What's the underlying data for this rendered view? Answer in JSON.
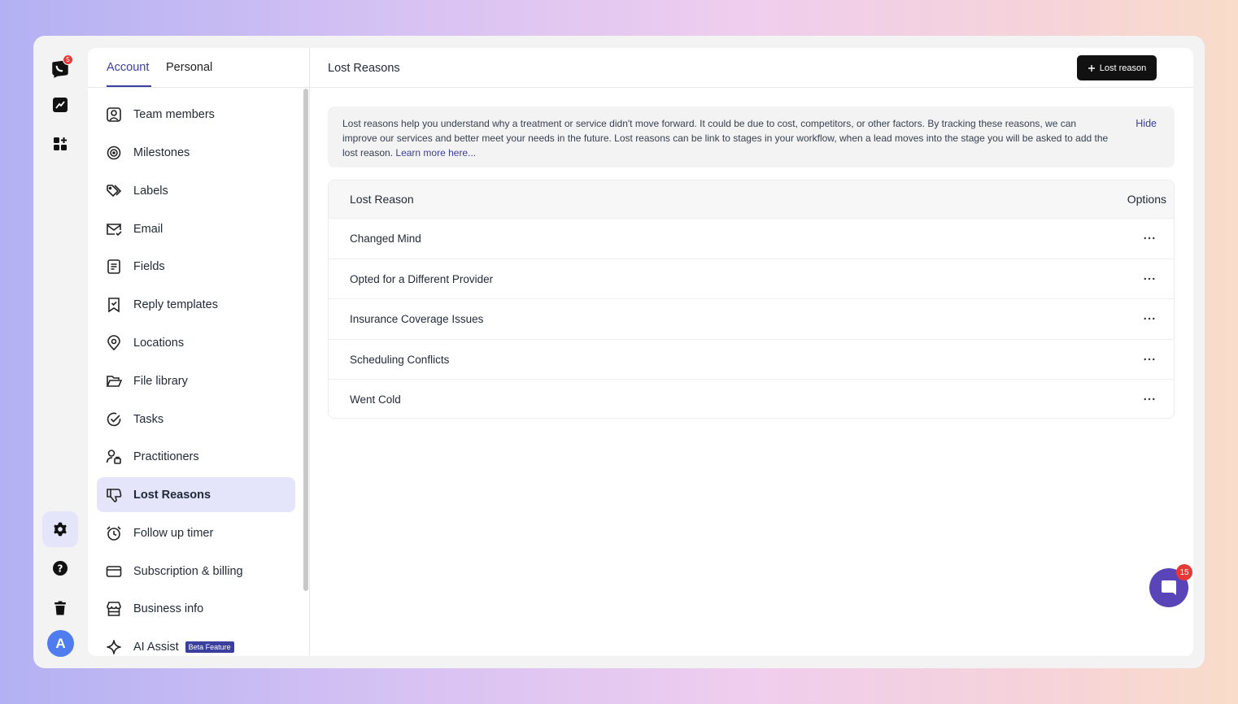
{
  "rail": {
    "logo_badge": "5",
    "avatar_initial": "A"
  },
  "tabs": {
    "account": "Account",
    "personal": "Personal"
  },
  "menu": {
    "items": [
      {
        "label": "Team members",
        "icon": "user-square-icon"
      },
      {
        "label": "Milestones",
        "icon": "target-icon"
      },
      {
        "label": "Labels",
        "icon": "tags-icon"
      },
      {
        "label": "Email",
        "icon": "mail-icon"
      },
      {
        "label": "Fields",
        "icon": "fields-icon"
      },
      {
        "label": "Reply templates",
        "icon": "bookmark-icon"
      },
      {
        "label": "Locations",
        "icon": "map-pin-icon"
      },
      {
        "label": "File library",
        "icon": "folder-icon"
      },
      {
        "label": "Tasks",
        "icon": "check-circle-icon"
      },
      {
        "label": "Practitioners",
        "icon": "practitioner-icon"
      },
      {
        "label": "Lost Reasons",
        "icon": "thumbs-down-icon"
      },
      {
        "label": "Follow up timer",
        "icon": "alarm-clock-icon"
      },
      {
        "label": "Subscription & billing",
        "icon": "credit-card-icon"
      },
      {
        "label": "Business info",
        "icon": "store-icon"
      },
      {
        "label": "AI Assist",
        "icon": "sparkle-icon"
      }
    ],
    "beta_label": "Beta Feature",
    "active": "Lost Reasons"
  },
  "main": {
    "title": "Lost Reasons",
    "add_button": "Lost reason",
    "info_text": "Lost reasons help you understand why a treatment or service didn't move forward. It could be due to cost, competitors, or other factors. By tracking these reasons, we can improve our services and better meet your needs in the future. Lost reasons can be link to stages in your workflow, when a lead moves into the stage you will be asked to add the lost reason.",
    "learn_more": "Learn more here...",
    "hide": "Hide",
    "table": {
      "col_reason": "Lost Reason",
      "col_options": "Options",
      "rows": [
        "Changed Mind",
        "Opted for a Different Provider",
        "Insurance Coverage Issues",
        "Scheduling Conflicts",
        "Went Cold"
      ]
    }
  },
  "chat": {
    "badge": "15"
  },
  "colors": {
    "accent": "#3a3f9e",
    "active_bg": "#e4e5fb",
    "chat": "#5a45b8",
    "badge": "#e53935"
  }
}
